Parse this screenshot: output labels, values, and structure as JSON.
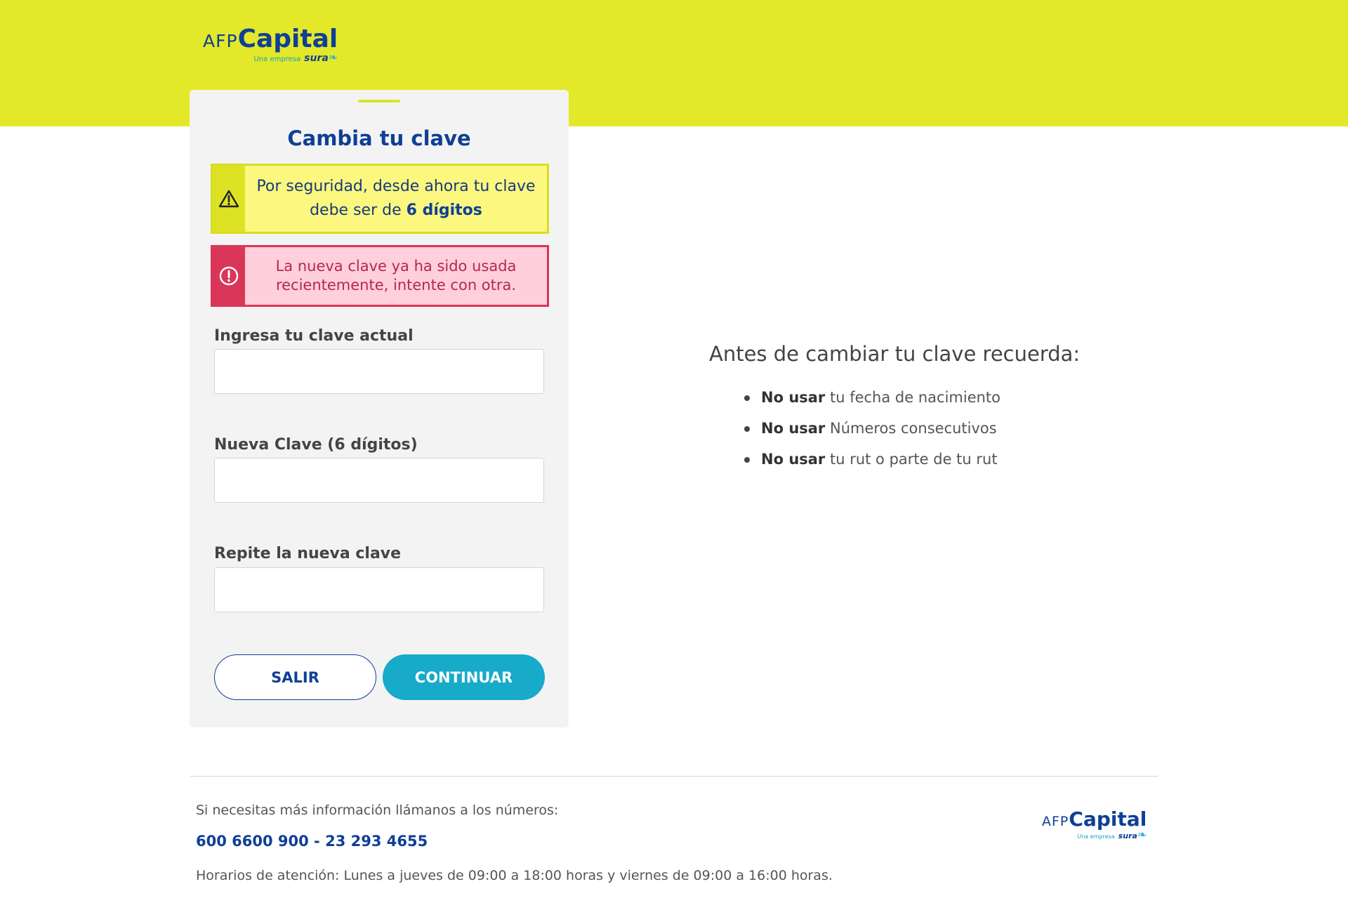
{
  "logo": {
    "afp": "AFP",
    "capital": "Capital",
    "tagline": "Una empresa",
    "sura": "sura"
  },
  "colors": {
    "banner": "#e3e829",
    "brand_blue": "#0f3f96",
    "primary_button": "#17aac9",
    "warning_bg": "#fbf77f",
    "error_bg": "#ffcfdb",
    "error_border": "#d9365a"
  },
  "form": {
    "title": "Cambia tu clave",
    "warning": {
      "icon": "warning-triangle-icon",
      "text": "Por seguridad, desde ahora tu clave debe ser de",
      "bold": "6 dígitos"
    },
    "error": {
      "icon": "exclamation-circle-icon",
      "text": "La nueva clave ya ha sido usada recientemente, intente con otra."
    },
    "fields": [
      {
        "label": "Ingresa tu clave actual",
        "value": ""
      },
      {
        "label": "Nueva Clave (6 dígitos)",
        "value": ""
      },
      {
        "label": "Repite la nueva clave",
        "value": ""
      }
    ],
    "buttons": {
      "exit": "SALIR",
      "continue": "CONTINUAR"
    }
  },
  "remember": {
    "title": "Antes de cambiar tu clave recuerda:",
    "items": [
      {
        "bold": "No usar",
        "text": "tu fecha de nacimiento"
      },
      {
        "bold": "No usar",
        "text": "Números consecutivos"
      },
      {
        "bold": "No usar",
        "text": "tu rut o parte de tu rut"
      }
    ]
  },
  "footer": {
    "info": "Si necesitas más información llámanos a los números:",
    "phones": "600 6600 900 - 23 293 4655",
    "hours": "Horarios de atención: Lunes a jueves de 09:00 a 18:00 horas y viernes de 09:00 a 16:00 horas."
  }
}
